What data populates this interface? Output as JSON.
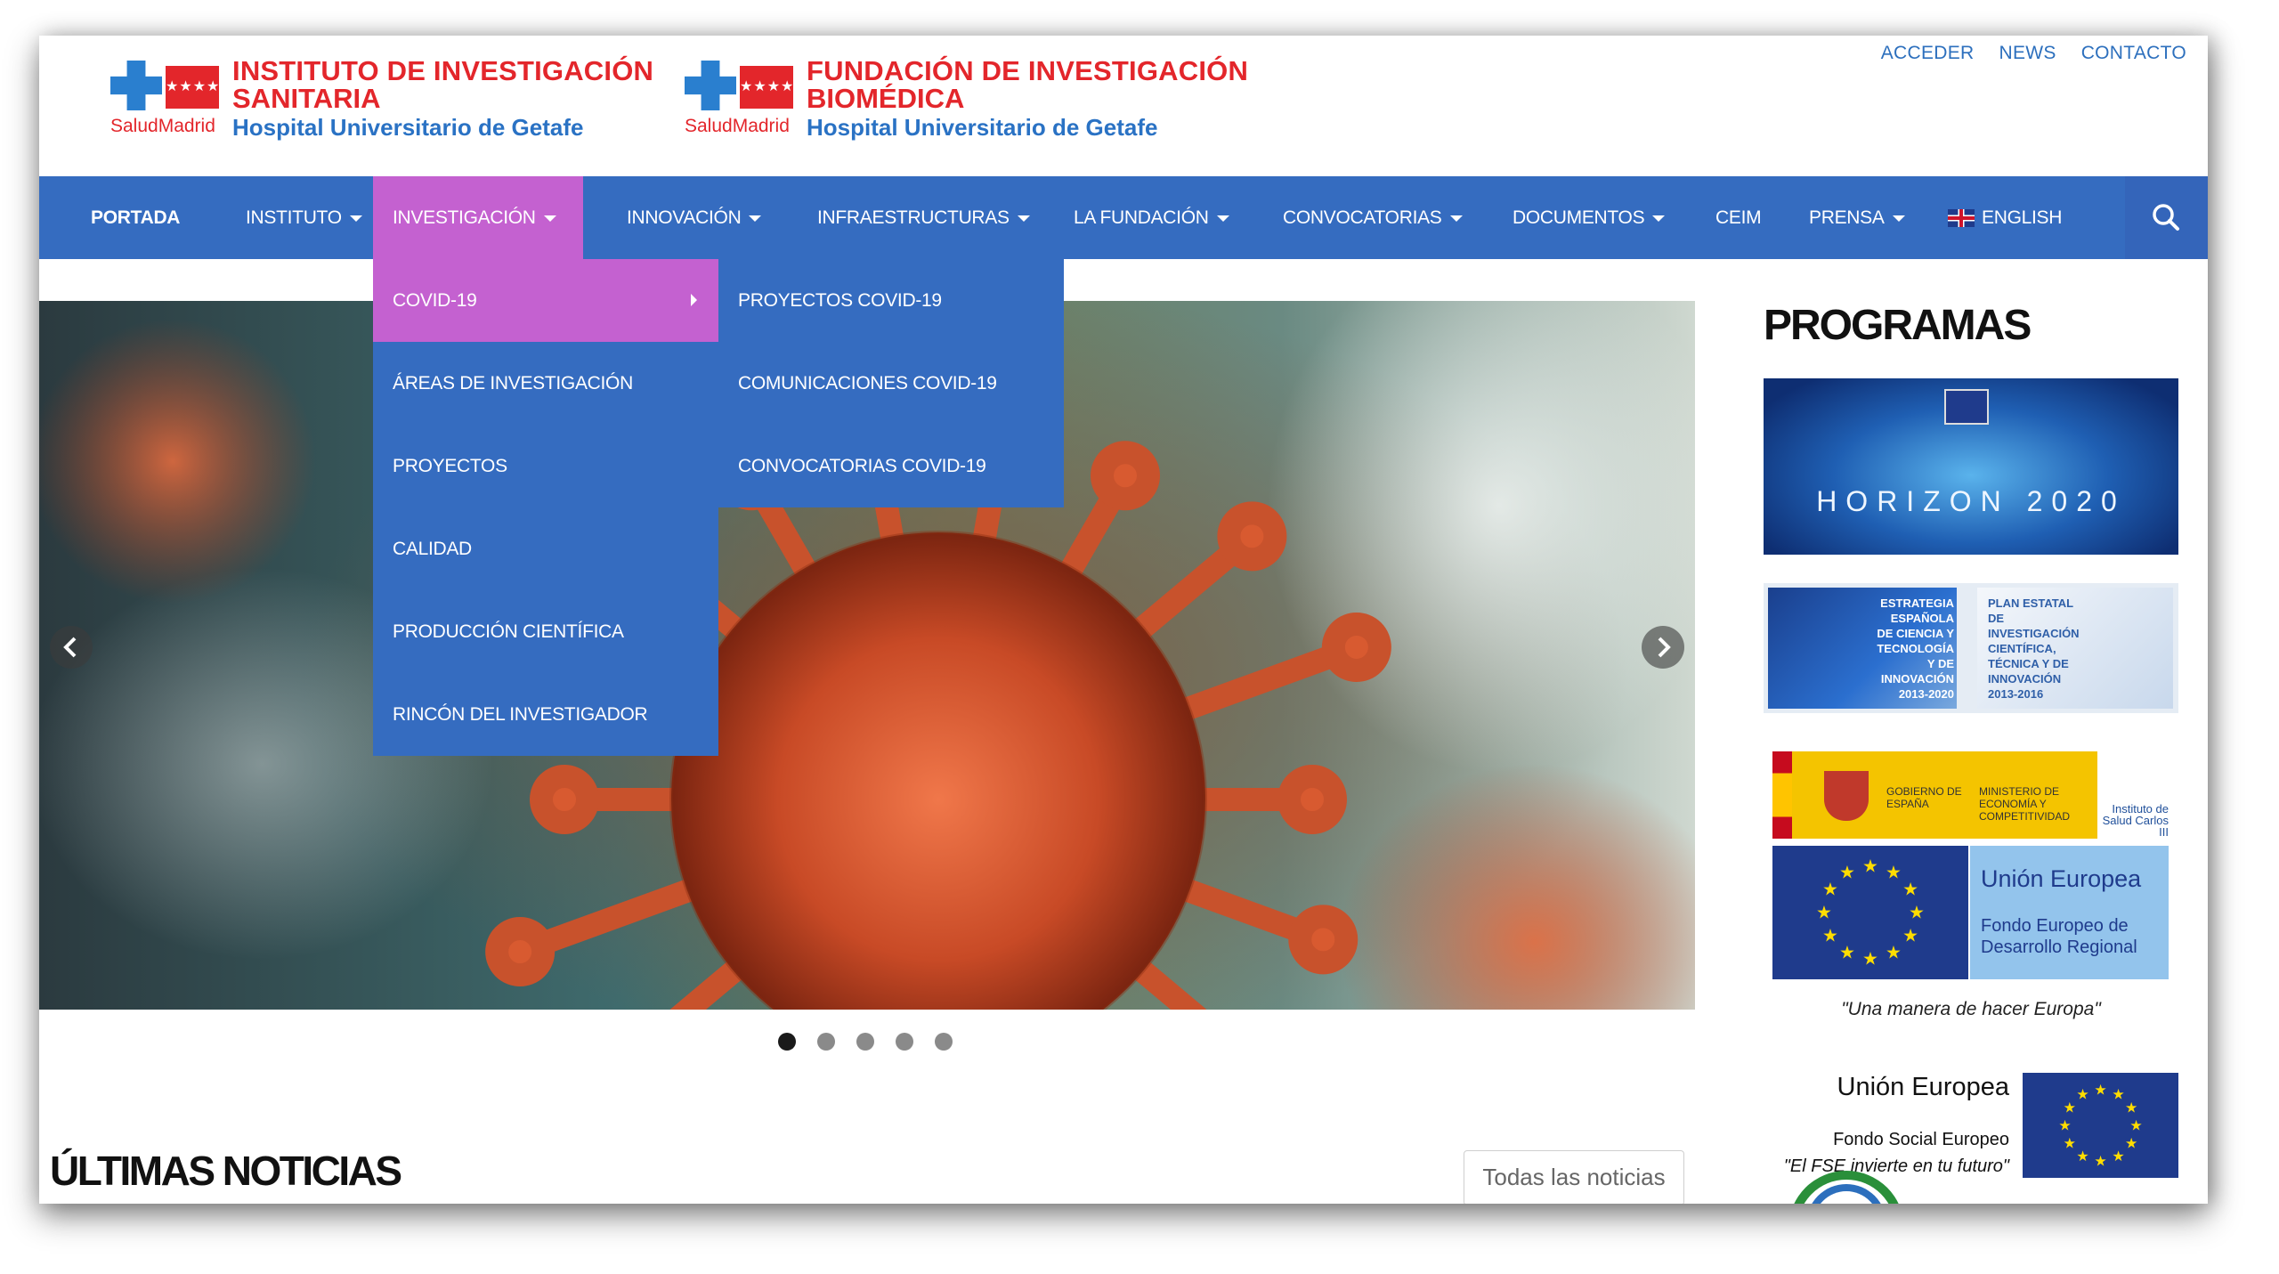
{
  "header": {
    "brand1": {
      "line1": "INSTITUTO DE INVESTIGACIÓN",
      "line2": "SANITARIA",
      "line3": "Hospital Universitario de Getafe",
      "sub": "SaludMadrid"
    },
    "brand2": {
      "line1": "FUNDACIÓN DE INVESTIGACIÓN",
      "line2": "BIOMÉDICA",
      "line3": "Hospital Universitario de Getafe",
      "sub": "SaludMadrid"
    },
    "toplinks": [
      "ACCEDER",
      "NEWS",
      "CONTACTO"
    ]
  },
  "nav": {
    "items": [
      {
        "label": "PORTADA"
      },
      {
        "label": "INSTITUTO"
      },
      {
        "label": "INVESTIGACIÓN"
      },
      {
        "label": "INNOVACIÓN"
      },
      {
        "label": "INFRAESTRUCTURAS"
      },
      {
        "label": "LA FUNDACIÓN"
      },
      {
        "label": "CONVOCATORIAS"
      },
      {
        "label": "DOCUMENTOS"
      },
      {
        "label": "CEIM"
      },
      {
        "label": "PRENSA"
      },
      {
        "label": "ENGLISH"
      }
    ],
    "active": "INVESTIGACIÓN"
  },
  "dropdown": {
    "items": [
      {
        "label": "COVID-19"
      },
      {
        "label": "ÁREAS DE INVESTIGACIÓN"
      },
      {
        "label": "PROYECTOS"
      },
      {
        "label": "CALIDAD"
      },
      {
        "label": "PRODUCCIÓN CIENTÍFICA"
      },
      {
        "label": "RINCÓN DEL INVESTIGADOR"
      }
    ],
    "submenu": [
      {
        "label": "PROYECTOS COVID-19"
      },
      {
        "label": "COMUNICACIONES COVID-19"
      },
      {
        "label": "CONVOCATORIAS COVID-19"
      }
    ]
  },
  "slider": {
    "current": 1,
    "total": 5
  },
  "news": {
    "title": "ÚLTIMAS NOTICIAS",
    "all_button": "Todas las noticias"
  },
  "sidebar": {
    "title": "PROGRAMAS",
    "horizon_label": "HORIZON 2020",
    "estrategia_text": "ESTRATEGIA ESPAÑOLA DE CIENCIA Y TECNOLOGÍA Y DE INNOVACIÓN 2013-2020",
    "plan_text": "PLAN ESTATAL DE INVESTIGACIÓN CIENTÍFICA, TÉCNICA Y DE INNOVACIÓN 2013-2016",
    "gobierno": "GOBIERNO DE ESPAÑA",
    "ministerio": "MINISTERIO DE ECONOMÍA Y COMPETITIVIDAD",
    "isciii": "Instituto de Salud Carlos III",
    "eu_title": "Unión Europea",
    "feder": "Fondo Europeo de Desarrollo Regional",
    "feder_motto": "\"Una manera de hacer Europa\"",
    "fse_title": "Unión Europea",
    "fse_sub": "Fondo Social Europeo",
    "fse_motto": "\"El FSE invierte en tu futuro\""
  },
  "colors": {
    "nav": "#356cc0",
    "active": "#c461d0",
    "brand_red": "#e3262b",
    "brand_blue": "#2a72c4"
  }
}
